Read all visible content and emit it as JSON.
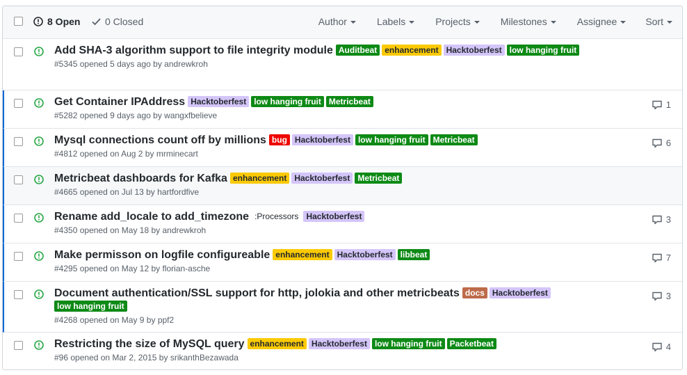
{
  "toolbar": {
    "open_label": "8 Open",
    "closed_label": "0 Closed",
    "filters": [
      "Author",
      "Labels",
      "Projects",
      "Milestones",
      "Assignee",
      "Sort"
    ]
  },
  "colors": {
    "open_green": "#28a745",
    "unread_bar": "#0366d6"
  },
  "issues": [
    {
      "title": "Add SHA-3 algorithm support to file integrity module",
      "labels": [
        {
          "text": "Auditbeat",
          "bg": "#0e8a16",
          "fg": "#ffffff"
        },
        {
          "text": "enhancement",
          "bg": "#fbca04",
          "fg": "#24292e"
        },
        {
          "text": "Hacktoberfest",
          "bg": "#d4c5f9",
          "fg": "#24292e"
        },
        {
          "text": "low hanging fruit",
          "bg": "#0e8a16",
          "fg": "#ffffff"
        }
      ],
      "number": "#5345",
      "opened": "opened 5 days ago by",
      "author": "andrewkroh",
      "comments": ""
    },
    {
      "title": "Get Container IPAddress",
      "labels": [
        {
          "text": "Hacktoberfest",
          "bg": "#d4c5f9",
          "fg": "#24292e"
        },
        {
          "text": "low hanging fruit",
          "bg": "#0e8a16",
          "fg": "#ffffff"
        },
        {
          "text": "Metricbeat",
          "bg": "#0e8a16",
          "fg": "#ffffff"
        }
      ],
      "number": "#5282",
      "opened": "opened 9 days ago by",
      "author": "wangxfbelieve",
      "comments": "1"
    },
    {
      "title": "Mysql connections count off by millions",
      "labels": [
        {
          "text": "bug",
          "bg": "#ee0701",
          "fg": "#ffffff"
        },
        {
          "text": "Hacktoberfest",
          "bg": "#d4c5f9",
          "fg": "#24292e"
        },
        {
          "text": "low hanging fruit",
          "bg": "#0e8a16",
          "fg": "#ffffff"
        },
        {
          "text": "Metricbeat",
          "bg": "#0e8a16",
          "fg": "#ffffff"
        }
      ],
      "number": "#4812",
      "opened": "opened on Aug 2 by",
      "author": "mrminecart",
      "comments": "6"
    },
    {
      "title": "Metricbeat dashboards for Kafka",
      "labels": [
        {
          "text": "enhancement",
          "bg": "#fbca04",
          "fg": "#24292e"
        },
        {
          "text": "Hacktoberfest",
          "bg": "#d4c5f9",
          "fg": "#24292e"
        },
        {
          "text": "Metricbeat",
          "bg": "#0e8a16",
          "fg": "#ffffff"
        }
      ],
      "number": "#4665",
      "opened": "opened on Jul 13 by",
      "author": "hartfordfive",
      "comments": ""
    },
    {
      "title": "Rename add_locale to add_timezone",
      "labels": [
        {
          "text": ":Processors",
          "bg": "#ffffff",
          "fg": "#24292e",
          "normal": true
        },
        {
          "text": "Hacktoberfest",
          "bg": "#d4c5f9",
          "fg": "#24292e"
        }
      ],
      "number": "#4350",
      "opened": "opened on May 18 by",
      "author": "andrewkroh",
      "comments": "3"
    },
    {
      "title": "Make permisson on logfile configureable",
      "labels": [
        {
          "text": "enhancement",
          "bg": "#fbca04",
          "fg": "#24292e"
        },
        {
          "text": "Hacktoberfest",
          "bg": "#d4c5f9",
          "fg": "#24292e"
        },
        {
          "text": "libbeat",
          "bg": "#0e8a16",
          "fg": "#ffffff"
        }
      ],
      "number": "#4295",
      "opened": "opened on May 12 by",
      "author": "florian-asche",
      "comments": "7"
    },
    {
      "title": "Document authentication/SSL support for http, jolokia and other metricbeats",
      "labels": [
        {
          "text": "docs",
          "bg": "#bd6b4a",
          "fg": "#ffffff"
        },
        {
          "text": "Hacktoberfest",
          "bg": "#d4c5f9",
          "fg": "#24292e"
        },
        {
          "text": "low hanging fruit",
          "bg": "#0e8a16",
          "fg": "#ffffff"
        }
      ],
      "number": "#4268",
      "opened": "opened on May 9 by",
      "author": "ppf2",
      "comments": "3"
    },
    {
      "title": "Restricting the size of MySQL query",
      "labels": [
        {
          "text": "enhancement",
          "bg": "#fbca04",
          "fg": "#24292e"
        },
        {
          "text": "Hacktoberfest",
          "bg": "#d4c5f9",
          "fg": "#24292e"
        },
        {
          "text": "low hanging fruit",
          "bg": "#0e8a16",
          "fg": "#ffffff"
        },
        {
          "text": "Packetbeat",
          "bg": "#0e8a16",
          "fg": "#ffffff"
        }
      ],
      "number": "#96",
      "opened": "opened on Mar 2, 2015 by",
      "author": "srikanthBezawada",
      "comments": "4"
    }
  ]
}
